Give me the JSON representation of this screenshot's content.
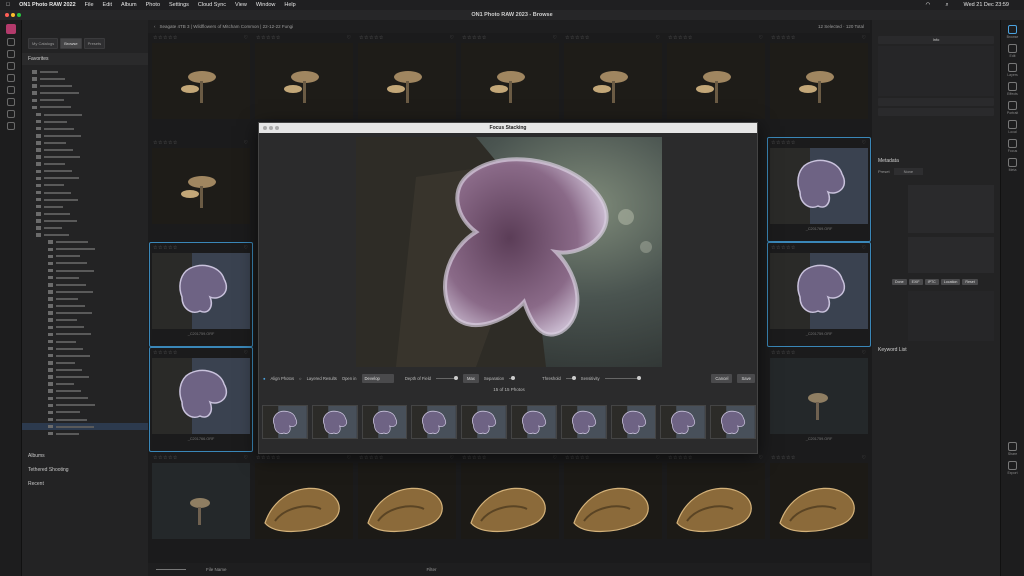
{
  "menubar": {
    "apple": "",
    "app": "ON1 Photo RAW 2022",
    "items": [
      "File",
      "Edit",
      "Album",
      "Photo",
      "Settings",
      "Cloud Sync",
      "View",
      "Window",
      "Help"
    ],
    "clock": "Wed 21 Dec 23:59"
  },
  "window": {
    "title": "ON1 Photo RAW 2023 - Browse"
  },
  "leftpanel": {
    "tabs": [
      "My Catalogs",
      "Browse",
      "Presets"
    ],
    "favorites_label": "Favorites",
    "albums_label": "Albums",
    "tethered_label": "Tethered Shooting",
    "recent_label": "Recent"
  },
  "grid": {
    "top_path": "Seagate 4TB 3  |  Wildflowers of Mitcham Common  |  22-12-22 Fungi",
    "top_right": "12 Selected · 120 Total",
    "filename": "_C201759.ORF",
    "filename2": "_C201766.ORF",
    "filename3": "_C201769.ORF"
  },
  "bottombar": {
    "sort": "File Name",
    "filter": "Filter"
  },
  "rightpanel": {
    "info": "Info",
    "metadata": "Metadata",
    "preset": "Preset",
    "preset_value": "None",
    "keyword": "Keyword List",
    "buttons": [
      "Done",
      "EXIF",
      "IPTC",
      "Location",
      "Reset"
    ]
  },
  "rightbar": {
    "items": [
      "Browse",
      "Edit",
      "Layers",
      "Effects",
      "Portrait",
      "Local",
      "Focus",
      "Meta",
      "Share",
      "Export"
    ]
  },
  "dialog": {
    "title": "Focus Stacking",
    "align": "Align Photos",
    "layered": "Layered Results",
    "open_in": "Open in",
    "open_value": "Develop",
    "dof": "Depth of Field",
    "max": "Max",
    "sep": "Separation",
    "threshold": "Threshold",
    "sensitivity": "Sensitivity",
    "cancel": "Cancel",
    "save": "Save",
    "count": "15 of 15 Photos"
  },
  "colors": {
    "accent": "#3a87b8",
    "selection": "#2c3a4e",
    "logo": "#b33a6b"
  }
}
